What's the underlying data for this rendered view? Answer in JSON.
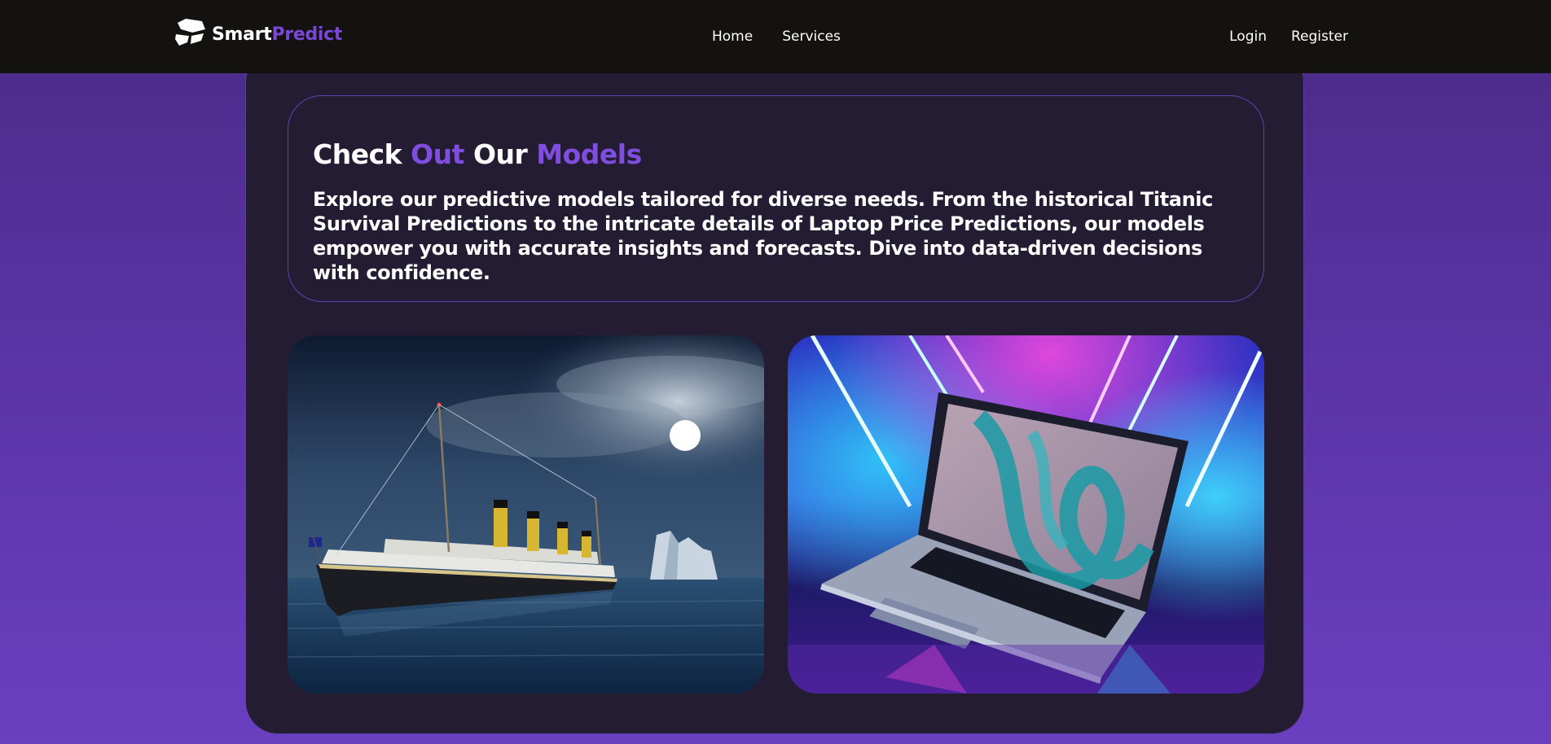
{
  "navbar": {
    "brand": {
      "part1": "Smart",
      "part2": "Predict",
      "accent_color": "#7b47d9"
    },
    "links": {
      "home": "Home",
      "services": "Services",
      "login": "Login",
      "register": "Register"
    }
  },
  "intro": {
    "title": {
      "w1": "Check",
      "w2": "Out",
      "w3": "Our",
      "w4": "Models"
    },
    "description": "Explore our predictive models tailored for diverse needs. From the historical Titanic Survival Predictions to the intricate details of Laptop Price Predictions, our models empower you with accurate insights and forecasts. Dive into data-driven decisions with confidence."
  },
  "models": [
    {
      "image": "titanic-ship-at-night-with-iceberg-image"
    },
    {
      "image": "laptop-with-neon-lights-image"
    }
  ],
  "colors": {
    "background_top": "#4a2a86",
    "background_bottom": "#6a3fc0",
    "navbar": "#141210",
    "card": "#241c33",
    "accent": "#7f4de0"
  }
}
